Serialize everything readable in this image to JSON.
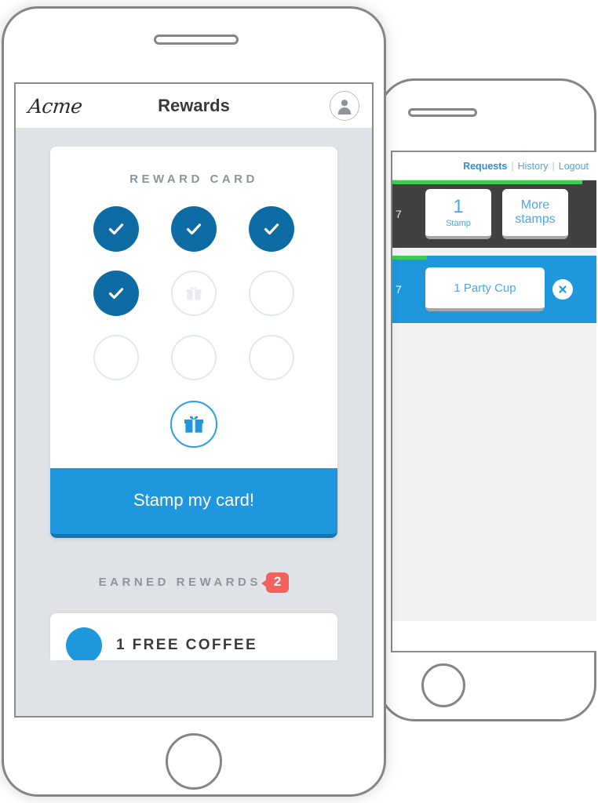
{
  "colors": {
    "stamp_filled": "#0e6ca5",
    "button_blue": "#1f97dd",
    "badge_red": "#f4605a",
    "progress_green": "#3fcc52",
    "app_background": "#dfe3e8",
    "link_blue": "#4aa8e8",
    "dark_row": "#414141"
  },
  "phone_left": {
    "header": {
      "brand": "Acme",
      "title": "Rewards",
      "avatar_icon": "user-avatar-icon"
    },
    "reward_card": {
      "title": "REWARD CARD",
      "stamps": [
        {
          "state": "filled",
          "icon": "check-icon"
        },
        {
          "state": "filled",
          "icon": "check-icon"
        },
        {
          "state": "filled",
          "icon": "check-icon"
        },
        {
          "state": "filled",
          "icon": "check-icon"
        },
        {
          "state": "empty",
          "icon": "gift-icon"
        },
        {
          "state": "empty",
          "icon": ""
        },
        {
          "state": "empty",
          "icon": ""
        },
        {
          "state": "empty",
          "icon": ""
        },
        {
          "state": "empty",
          "icon": ""
        }
      ],
      "stamps_filled_count": 4,
      "stamps_total": 9,
      "reward_icon": "gift-icon",
      "stamp_button_label": "Stamp my card!"
    },
    "earned": {
      "label": "EARNED REWARDS",
      "count": "2",
      "items": [
        {
          "label": "1 FREE COFFEE",
          "icon": "coffee-circle-icon"
        }
      ]
    }
  },
  "phone_right": {
    "nav": {
      "requests": "Requests",
      "history": "History",
      "logout": "Logout",
      "separator": "|"
    },
    "requests": [
      {
        "fragment": "7",
        "style": "dark",
        "progress_percent": 93,
        "buttons": [
          {
            "value": "1",
            "label": "Stamp",
            "name": "stamp-count-button"
          },
          {
            "label": "More stamps",
            "name": "more-stamps-button"
          }
        ]
      },
      {
        "fragment": "7",
        "style": "blue",
        "progress_percent": 17,
        "buttons": [
          {
            "label": "1 Party Cup",
            "name": "party-cup-button"
          }
        ],
        "close_icon": "close-x-icon"
      }
    ]
  }
}
